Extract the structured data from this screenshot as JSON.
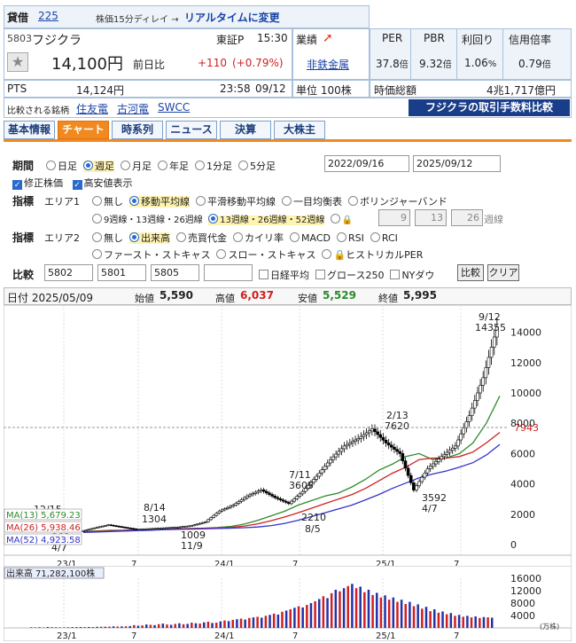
{
  "header": {
    "lending": "貸借",
    "index_link": "225",
    "delay_note": "株価15分ディレイ → ",
    "realtime_link": "リアルタイムに変更",
    "code": "5803",
    "name": "フジクラ",
    "market": "東証P",
    "time": "15:30",
    "price": "14,100円",
    "prev_label": "前日比",
    "change": "+110",
    "change_pct": "(+0.79%)",
    "pts_label": "PTS",
    "pts_price": "14,124円",
    "pts_time": "23:58",
    "pts_date": "09/12",
    "compare_label": "比較される銘柄",
    "compare_links": [
      "住友電",
      "古河電",
      "SWCC"
    ]
  },
  "metrics": {
    "gyoseki": "業績",
    "sector": "非鉄金属",
    "unit": "単位 100株",
    "per_label": "PER",
    "pbr_label": "PBR",
    "yield_label": "利回り",
    "margin_label": "信用倍率",
    "per": "37.8",
    "per_unit": "倍",
    "pbr": "9.32",
    "pbr_unit": "倍",
    "yield": "1.06",
    "yield_unit": "%",
    "margin": "0.79",
    "margin_unit": "倍",
    "mcap_label": "時価総額",
    "mcap": "4兆1,717億円",
    "fee_link": "フジクラの取引手数料比較"
  },
  "tabs": [
    "基本情報",
    "チャート",
    "時系列",
    "ニュース",
    "決算",
    "大株主"
  ],
  "controls": {
    "period_label": "期間",
    "periods": [
      "日足",
      "週足",
      "月足",
      "年足",
      "1分足",
      "5分足"
    ],
    "date_from": "2022/09/16",
    "date_to": "2025/09/12",
    "adj_label": "修正株価",
    "hiacc_label": "高安値表示",
    "ind_label": "指標",
    "area1": "エリア1",
    "area1_opts": [
      "無し",
      "移動平均線",
      "平滑移動平均線",
      "一目均衡表",
      "ボリンジャーバンド"
    ],
    "ma_opt1": "9週線・13週線・26週線",
    "ma_opt2": "13週線・26週線・52週線",
    "ma_custom": [
      "9",
      "13",
      "26"
    ],
    "ma_custom_unit": "週線",
    "area2": "エリア2",
    "area2_opts": [
      "無し",
      "出来高",
      "売買代金",
      "カイリ率",
      "MACD",
      "RSI",
      "RCI"
    ],
    "area2_opts2": [
      "ファースト・ストキャス",
      "スロー・ストキャス",
      "ヒストリカルPER"
    ],
    "cmp_label": "比較",
    "cmp_inputs": [
      "5802",
      "5801",
      "5805",
      ""
    ],
    "cmp_checks": [
      "日経平均",
      "グロース250",
      "NYダウ"
    ],
    "cmp_btn": "比較",
    "clear_btn": "クリア"
  },
  "ohlc": {
    "date_label": "日付",
    "date": "2025/05/09",
    "open_label": "始値",
    "open": "5,590",
    "high_label": "高値",
    "high": "6,037",
    "low_label": "安値",
    "low": "5,529",
    "close_label": "終値",
    "close": "5,995"
  },
  "chart_data": {
    "type": "line",
    "series": [
      {
        "name": "MA(13)",
        "label_value": "5,679.23",
        "color": "#2e8b2e",
        "values": [
          860,
          900,
          940,
          950,
          980,
          1010,
          1020,
          1040,
          1060,
          1080,
          1120,
          1200,
          1350,
          1600,
          1900,
          2200,
          2600,
          2900,
          3200,
          3400,
          3800,
          4300,
          4900,
          5300,
          5800,
          6000,
          5600,
          5700,
          6000,
          6700,
          8000,
          9800
        ]
      },
      {
        "name": "MA(26)",
        "label_value": "5,938.46",
        "color": "#cc2222",
        "values": [
          840,
          870,
          900,
          930,
          960,
          990,
          1010,
          1030,
          1050,
          1070,
          1090,
          1130,
          1220,
          1370,
          1580,
          1820,
          2100,
          2400,
          2700,
          3000,
          3300,
          3700,
          4200,
          4700,
          5100,
          5600,
          5700,
          5700,
          5800,
          6100,
          6700,
          7400
        ]
      },
      {
        "name": "MA(52)",
        "label_value": "4,923.58",
        "color": "#3333cc",
        "values": [
          800,
          830,
          860,
          890,
          920,
          950,
          980,
          1000,
          1020,
          1040,
          1060,
          1080,
          1110,
          1160,
          1250,
          1400,
          1600,
          1850,
          2100,
          2350,
          2600,
          2950,
          3300,
          3700,
          4050,
          4400,
          4650,
          4850,
          5100,
          5400,
          5900,
          6600
        ]
      },
      {
        "name": "price",
        "color": "#000000",
        "values": [
          863,
          1100,
          1300,
          1150,
          1009,
          1050,
          1100,
          1150,
          1250,
          1500,
          2210,
          2600,
          3200,
          3605,
          3100,
          2700,
          3500,
          4500,
          5600,
          6500,
          7000,
          7620,
          6700,
          6000,
          3592,
          5000,
          5800,
          6500,
          8500,
          11000,
          14355
        ]
      }
    ],
    "annotations": [
      {
        "text": "12/15",
        "val": ""
      },
      {
        "text": "863"
      },
      {
        "text": "4/7"
      },
      {
        "text": "8/14"
      },
      {
        "text": "1304"
      },
      {
        "text": "1009"
      },
      {
        "text": "11/9"
      },
      {
        "text": "7/11"
      },
      {
        "text": "3605"
      },
      {
        "text": "2210"
      },
      {
        "text": "8/5"
      },
      {
        "text": "2/13"
      },
      {
        "text": "7620"
      },
      {
        "text": "3592"
      },
      {
        "text": "4/7"
      },
      {
        "text": "9/12"
      },
      {
        "text": "14355"
      }
    ],
    "y_ticks": [
      "14000",
      "12000",
      "10000",
      "8000",
      "6000",
      "4000",
      "2000",
      "0"
    ],
    "last_price_marker": "7943",
    "x_ticks": [
      "23/1",
      "7",
      "24/1",
      "7",
      "25/1",
      "7"
    ],
    "ylim": [
      0,
      15000
    ]
  },
  "volume": {
    "label": "出来高",
    "value": "71,282,100株",
    "y_ticks": [
      "16000",
      "12000",
      "8000",
      "4000"
    ],
    "unit": "(万株)",
    "bars": [
      200,
      180,
      220,
      150,
      300,
      250,
      200,
      180,
      160,
      220,
      250,
      300,
      280,
      260,
      300,
      280,
      350,
      400,
      380,
      420,
      500,
      450,
      480,
      520,
      600,
      900,
      700,
      800,
      1100,
      1000,
      900,
      1200,
      1400,
      1100,
      1000,
      1300,
      1500,
      1200,
      1300,
      1700,
      1500,
      1400,
      1800,
      2000,
      1600,
      1700,
      2100,
      2400,
      2200,
      2600,
      2800,
      3000,
      2700,
      3200,
      3400,
      3600,
      3300,
      3900,
      4200,
      4600,
      4300,
      5200,
      5600,
      6000,
      6500,
      7000,
      6600,
      7400,
      8000,
      8600,
      9300,
      10200,
      9600,
      11200,
      12300,
      11800,
      12800,
      13500,
      14200,
      12800,
      13300,
      11500,
      12300,
      10600,
      11300,
      9800,
      10500,
      9100,
      9800,
      8400,
      9100,
      7700,
      8400,
      7000,
      7600,
      6200,
      6800,
      5400,
      6000,
      4900,
      5300,
      4400,
      4800,
      3900,
      4200,
      3600,
      3900,
      3400,
      3700,
      3200,
      3500,
      3400,
      3300
    ]
  }
}
